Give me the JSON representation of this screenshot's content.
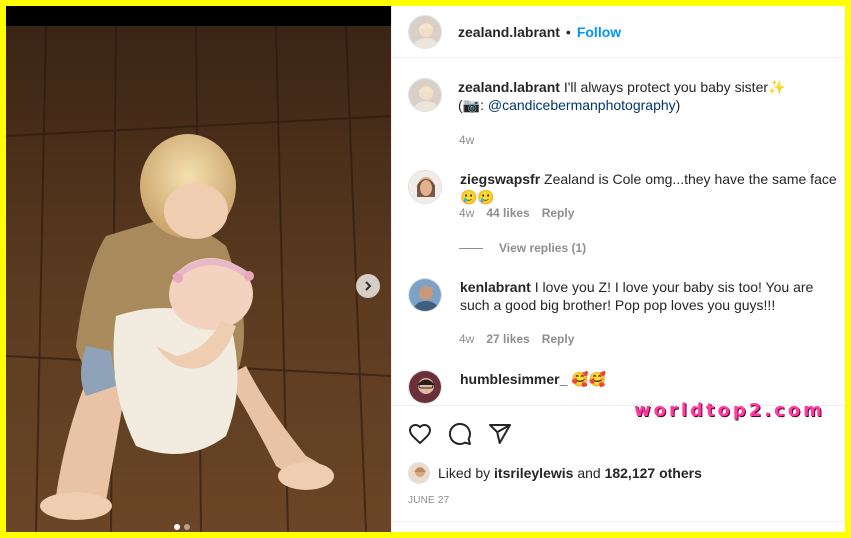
{
  "post": {
    "author": "zealand.labrant",
    "separator": "•",
    "follow_label": "Follow",
    "photo_alt": "Toddler hugging newborn baby sister on wooden floor",
    "carousel": {
      "count": 2,
      "active": 0
    }
  },
  "caption": {
    "username": "zealand.labrant",
    "text": "I'll always protect you baby sister✨",
    "credit_prefix": "(📷: ",
    "credit_mention": "@candicebermanphotography",
    "credit_suffix": ")",
    "time": "4w"
  },
  "comments": [
    {
      "username": "ziegswapsfr",
      "text": "Zealand is Cole omg...they have the same face🥲🥲",
      "time": "4w",
      "likes": "44 likes",
      "reply": "Reply",
      "view_replies": "View replies (1)"
    },
    {
      "username": "kenlabrant",
      "text": "I love you Z! I love your baby sis too! You are such a good big brother! Pop pop loves you guys!!!",
      "time": "4w",
      "likes": "27 likes",
      "reply": "Reply"
    },
    {
      "username": "humblesimmer_",
      "text": "🥰🥰"
    }
  ],
  "liked_by": {
    "prefix": "Liked by ",
    "user": "itsrileylewis",
    "middle": " and ",
    "count": "182,127 others"
  },
  "date": "JUNE 27",
  "watermark": "worldtop2.com",
  "icons": {
    "like": "heart-icon",
    "comment": "comment-icon",
    "share": "share-icon",
    "next": "chevron-right-icon"
  }
}
